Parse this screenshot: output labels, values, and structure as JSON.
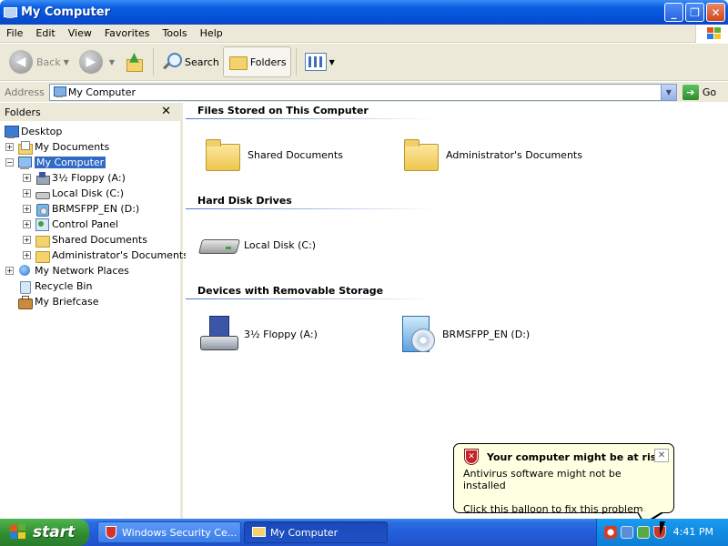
{
  "window": {
    "title": "My Computer",
    "buttons": {
      "minimize": "_",
      "maximize": "❐",
      "close": "✕"
    }
  },
  "menu": [
    "File",
    "Edit",
    "View",
    "Favorites",
    "Tools",
    "Help"
  ],
  "toolbar": {
    "back": "Back",
    "search": "Search",
    "folders": "Folders"
  },
  "address": {
    "label": "Address",
    "value": "My Computer",
    "go": "Go"
  },
  "folders_pane": {
    "title": "Folders",
    "close": "✕",
    "tree": [
      {
        "label": "Desktop",
        "icon": "desktop-icon",
        "level": 0,
        "expander": ""
      },
      {
        "label": "My Documents",
        "icon": "my-documents-icon",
        "level": 1,
        "expander": "+"
      },
      {
        "label": "My Computer",
        "icon": "my-computer-icon",
        "level": 1,
        "expander": "−",
        "selected": true
      },
      {
        "label": "3½ Floppy (A:)",
        "icon": "floppy-icon",
        "level": 2,
        "expander": "+"
      },
      {
        "label": "Local Disk (C:)",
        "icon": "hard-disk-icon",
        "level": 2,
        "expander": "+"
      },
      {
        "label": "BRMSFPP_EN (D:)",
        "icon": "cd-drive-icon",
        "level": 2,
        "expander": "+"
      },
      {
        "label": "Control Panel",
        "icon": "control-panel-icon",
        "level": 2,
        "expander": "+"
      },
      {
        "label": "Shared Documents",
        "icon": "folder-icon",
        "level": 2,
        "expander": "+"
      },
      {
        "label": "Administrator's Documents",
        "icon": "folder-icon",
        "level": 2,
        "expander": "+"
      },
      {
        "label": "My Network Places",
        "icon": "network-icon",
        "level": 1,
        "expander": "+"
      },
      {
        "label": "Recycle Bin",
        "icon": "recycle-bin-icon",
        "level": 1,
        "expander": ""
      },
      {
        "label": "My Briefcase",
        "icon": "briefcase-icon",
        "level": 1,
        "expander": ""
      }
    ]
  },
  "content": {
    "groups": [
      {
        "title": "Files Stored on This Computer",
        "items": [
          {
            "label": "Shared Documents",
            "icon": "folder-icon"
          },
          {
            "label": "Administrator's Documents",
            "icon": "folder-icon"
          }
        ]
      },
      {
        "title": "Hard Disk Drives",
        "items": [
          {
            "label": "Local Disk (C:)",
            "icon": "hard-disk-icon"
          }
        ]
      },
      {
        "title": "Devices with Removable Storage",
        "items": [
          {
            "label": "3½ Floppy (A:)",
            "icon": "floppy-drive-icon"
          },
          {
            "label": "BRMSFPP_EN (D:)",
            "icon": "cd-drive-icon"
          }
        ]
      }
    ]
  },
  "balloon": {
    "title": "Your computer might be at risk",
    "line1": "Antivirus software might not be installed",
    "line2": "Click this balloon to fix this problem."
  },
  "taskbar": {
    "start": "start",
    "tasks": [
      {
        "label": "Windows Security Ce...",
        "icon": "shield-icon",
        "active": false
      },
      {
        "label": "My Computer",
        "icon": "folder-icon",
        "active": true
      }
    ],
    "clock": "4:41 PM"
  }
}
